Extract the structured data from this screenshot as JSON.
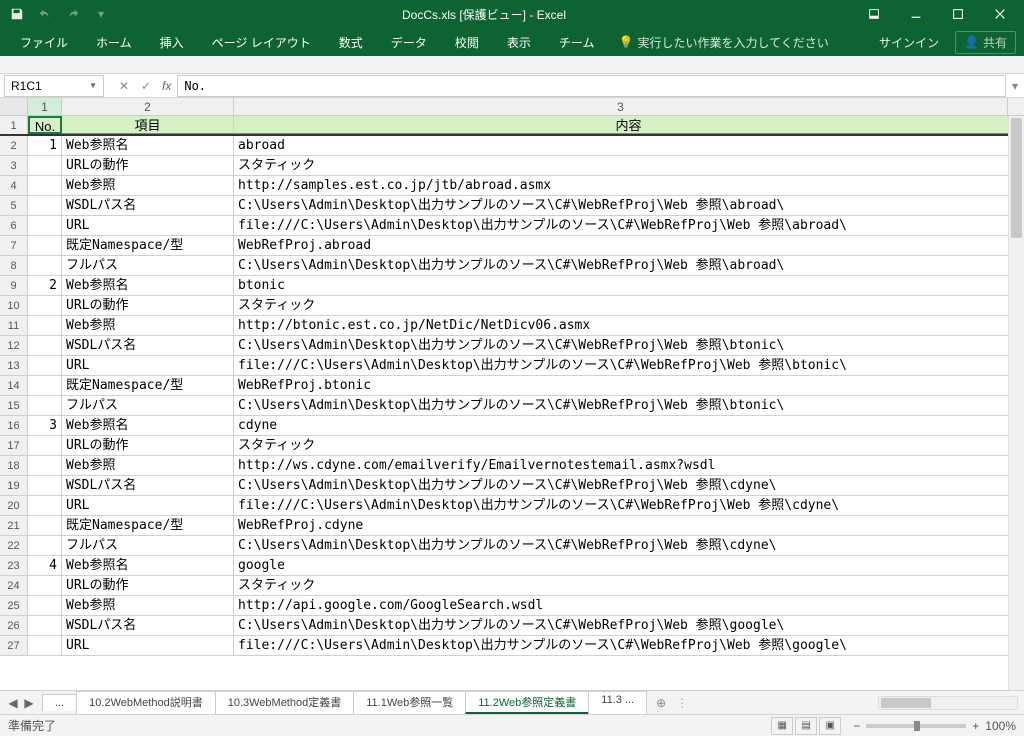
{
  "title": "DocCs.xls  [保護ビュー] - Excel",
  "qat": {
    "save": "save",
    "undo": "undo",
    "redo": "redo"
  },
  "win": {
    "signin": "サインイン",
    "share": "共有"
  },
  "tabs": [
    "ファイル",
    "ホーム",
    "挿入",
    "ページ レイアウト",
    "数式",
    "データ",
    "校閲",
    "表示",
    "チーム"
  ],
  "tellme": "実行したい作業を入力してください",
  "namebox": "R1C1",
  "formula": "No.",
  "colnums": [
    "1",
    "2",
    "3"
  ],
  "headers": {
    "c1": "No.",
    "c2": "項目",
    "c3": "内容"
  },
  "rows": [
    {
      "n": "2",
      "c1": "1",
      "c2": "Web参照名",
      "c3": "abroad"
    },
    {
      "n": "3",
      "c1": "",
      "c2": "URLの動作",
      "c3": "スタティック"
    },
    {
      "n": "4",
      "c1": "",
      "c2": "Web参照",
      "c3": "http://samples.est.co.jp/jtb/abroad.asmx"
    },
    {
      "n": "5",
      "c1": "",
      "c2": "WSDLパス名",
      "c3": "C:\\Users\\Admin\\Desktop\\出力サンプルのソース\\C#\\WebRefProj\\Web 参照\\abroad\\"
    },
    {
      "n": "6",
      "c1": "",
      "c2": "URL",
      "c3": "file:///C:\\Users\\Admin\\Desktop\\出力サンプルのソース\\C#\\WebRefProj\\Web 参照\\abroad\\"
    },
    {
      "n": "7",
      "c1": "",
      "c2": "既定Namespace/型",
      "c3": "WebRefProj.abroad"
    },
    {
      "n": "8",
      "c1": "",
      "c2": "フルパス",
      "c3": "C:\\Users\\Admin\\Desktop\\出力サンプルのソース\\C#\\WebRefProj\\Web 参照\\abroad\\"
    },
    {
      "n": "9",
      "c1": "2",
      "c2": "Web参照名",
      "c3": "btonic"
    },
    {
      "n": "10",
      "c1": "",
      "c2": "URLの動作",
      "c3": "スタティック"
    },
    {
      "n": "11",
      "c1": "",
      "c2": "Web参照",
      "c3": "http://btonic.est.co.jp/NetDic/NetDicv06.asmx"
    },
    {
      "n": "12",
      "c1": "",
      "c2": "WSDLパス名",
      "c3": "C:\\Users\\Admin\\Desktop\\出力サンプルのソース\\C#\\WebRefProj\\Web 参照\\btonic\\"
    },
    {
      "n": "13",
      "c1": "",
      "c2": "URL",
      "c3": "file:///C:\\Users\\Admin\\Desktop\\出力サンプルのソース\\C#\\WebRefProj\\Web 参照\\btonic\\"
    },
    {
      "n": "14",
      "c1": "",
      "c2": "既定Namespace/型",
      "c3": "WebRefProj.btonic"
    },
    {
      "n": "15",
      "c1": "",
      "c2": "フルパス",
      "c3": "C:\\Users\\Admin\\Desktop\\出力サンプルのソース\\C#\\WebRefProj\\Web 参照\\btonic\\"
    },
    {
      "n": "16",
      "c1": "3",
      "c2": "Web参照名",
      "c3": "cdyne"
    },
    {
      "n": "17",
      "c1": "",
      "c2": "URLの動作",
      "c3": "スタティック"
    },
    {
      "n": "18",
      "c1": "",
      "c2": "Web参照",
      "c3": "http://ws.cdyne.com/emailverify/Emailvernotestemail.asmx?wsdl"
    },
    {
      "n": "19",
      "c1": "",
      "c2": "WSDLパス名",
      "c3": "C:\\Users\\Admin\\Desktop\\出力サンプルのソース\\C#\\WebRefProj\\Web 参照\\cdyne\\"
    },
    {
      "n": "20",
      "c1": "",
      "c2": "URL",
      "c3": "file:///C:\\Users\\Admin\\Desktop\\出力サンプルのソース\\C#\\WebRefProj\\Web 参照\\cdyne\\"
    },
    {
      "n": "21",
      "c1": "",
      "c2": "既定Namespace/型",
      "c3": "WebRefProj.cdyne"
    },
    {
      "n": "22",
      "c1": "",
      "c2": "フルパス",
      "c3": "C:\\Users\\Admin\\Desktop\\出力サンプルのソース\\C#\\WebRefProj\\Web 参照\\cdyne\\"
    },
    {
      "n": "23",
      "c1": "4",
      "c2": "Web参照名",
      "c3": "google"
    },
    {
      "n": "24",
      "c1": "",
      "c2": "URLの動作",
      "c3": "スタティック"
    },
    {
      "n": "25",
      "c1": "",
      "c2": "Web参照",
      "c3": "http://api.google.com/GoogleSearch.wsdl"
    },
    {
      "n": "26",
      "c1": "",
      "c2": "WSDLパス名",
      "c3": "C:\\Users\\Admin\\Desktop\\出力サンプルのソース\\C#\\WebRefProj\\Web 参照\\google\\"
    },
    {
      "n": "27",
      "c1": "",
      "c2": "URL",
      "c3": "file:///C:\\Users\\Admin\\Desktop\\出力サンプルのソース\\C#\\WebRefProj\\Web 参照\\google\\"
    }
  ],
  "sheets": {
    "more": "...",
    "list": [
      "10.2WebMethod説明書",
      "10.3WebMethod定義書",
      "11.1Web参照一覧",
      "11.2Web参照定義書",
      "11.3 ..."
    ],
    "active": 3
  },
  "status": "準備完了",
  "zoom": "100%"
}
